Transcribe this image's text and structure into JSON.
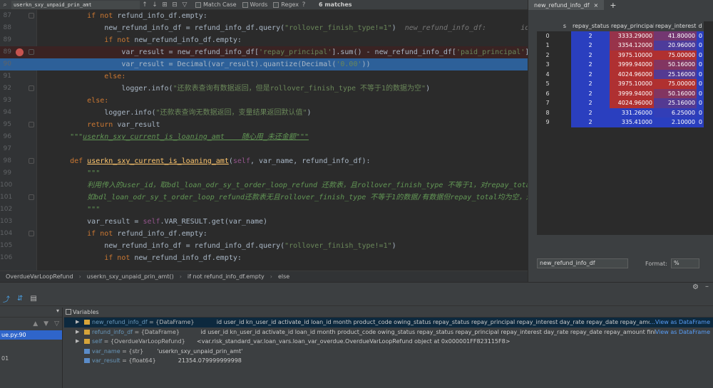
{
  "findbar": {
    "query": "userkn_sxy_unpaid_prin_amt",
    "match_case": "Match Case",
    "words": "Words",
    "regex": "Regex",
    "help": "?",
    "matches": "6 matches"
  },
  "editor": {
    "lines": [
      {
        "num": "87",
        "segments": [
          {
            "t": "        if not ",
            "c": "kw"
          },
          {
            "t": "refund_info_df.empty:",
            "c": ""
          }
        ]
      },
      {
        "num": "88",
        "segments": [
          {
            "t": "            new_refund_info_df = refund_info_df.query(",
            "c": ""
          },
          {
            "t": "\"rollover_finish_type!=1\"",
            "c": "st"
          },
          {
            "t": ")  ",
            "c": ""
          },
          {
            "t": "new_refund_info_df:        id   user_i",
            "c": "hint"
          }
        ]
      },
      {
        "num": "89",
        "segments": [
          {
            "t": "            if not ",
            "c": "kw"
          },
          {
            "t": "new_refund_info_df.empty:",
            "c": ""
          }
        ]
      },
      {
        "num": "89",
        "bp": true,
        "cls": "hl-red",
        "segments": [
          {
            "t": "                var_result = new_refund_info_df[",
            "c": ""
          },
          {
            "t": "'repay_principal'",
            "c": "st"
          },
          {
            "t": "].sum() - new_refund_info_df[",
            "c": ""
          },
          {
            "t": "'paid_principal'",
            "c": "st"
          },
          {
            "t": "].sum()",
            "c": ""
          }
        ]
      },
      {
        "num": "90",
        "cls": "hl-blue",
        "segments": [
          {
            "t": "                var_result = Decimal(var_result).quantize(Decimal(",
            "c": ""
          },
          {
            "t": "'0.00'",
            "c": "st"
          },
          {
            "t": "))",
            "c": ""
          }
        ]
      },
      {
        "num": "91",
        "segments": [
          {
            "t": "            else:",
            "c": "kw"
          }
        ]
      },
      {
        "num": "92",
        "segments": [
          {
            "t": "                logger.info(",
            "c": ""
          },
          {
            "t": "\"还款表查询有数据返回，但是rollover_finish_type 不等于1的数据为空\"",
            "c": "st"
          },
          {
            "t": ")",
            "c": ""
          }
        ]
      },
      {
        "num": "93",
        "segments": [
          {
            "t": "        else:",
            "c": "kw"
          }
        ]
      },
      {
        "num": "94",
        "segments": [
          {
            "t": "            logger.info(",
            "c": ""
          },
          {
            "t": "\"还款表查询无数据返回，变量结果返回默认值\"",
            "c": "st"
          },
          {
            "t": ")",
            "c": ""
          }
        ]
      },
      {
        "num": "95",
        "segments": [
          {
            "t": "        return ",
            "c": "kw"
          },
          {
            "t": "var_result",
            "c": ""
          }
        ]
      },
      {
        "num": "96",
        "segments": [
          {
            "t": "    \"\"\"",
            "c": "cm"
          },
          {
            "t": "userkn_sxy_current_is_loaning_amt    随心用_未还金额\"\"\"",
            "c": "cm ul"
          }
        ]
      },
      {
        "num": "97",
        "segments": [
          {
            "t": "",
            "c": ""
          }
        ]
      },
      {
        "num": "98",
        "segments": [
          {
            "t": "    def ",
            "c": "kw"
          },
          {
            "t": "userkn_sxy_current_is_loaning_amt",
            "c": "fn ul"
          },
          {
            "t": "(",
            "c": ""
          },
          {
            "t": "self",
            "c": "self"
          },
          {
            "t": ", var_name, refund_info_df):",
            "c": ""
          }
        ]
      },
      {
        "num": "99",
        "segments": [
          {
            "t": "        \"\"\"",
            "c": "cm"
          }
        ]
      },
      {
        "num": "100",
        "segments": [
          {
            "t": "        利用传入的user_id，取bdl_loan_odr_sy_t_order_loop_refund 还款表，且rollover_finish_type 不等于1，对repay_total",
            "c": "cm"
          }
        ]
      },
      {
        "num": "101",
        "segments": [
          {
            "t": "        如bdl_loan_odr_sy_t_order_loop_refund还款表无且rollover_finish_type 不等于1的数据/有数据但repay_total均为空，返回",
            "c": "cm"
          }
        ]
      },
      {
        "num": "102",
        "segments": [
          {
            "t": "        \"\"\"",
            "c": "cm"
          }
        ]
      },
      {
        "num": "103",
        "segments": [
          {
            "t": "        var_result = ",
            "c": ""
          },
          {
            "t": "self",
            "c": "self"
          },
          {
            "t": ".VAR_RESULT.get(var_name)",
            "c": ""
          }
        ]
      },
      {
        "num": "104",
        "segments": [
          {
            "t": "        if not ",
            "c": "kw"
          },
          {
            "t": "refund_info_df.empty:",
            "c": ""
          }
        ]
      },
      {
        "num": "105",
        "segments": [
          {
            "t": "            new_refund_info_df = refund_info_df.query(",
            "c": ""
          },
          {
            "t": "\"rollover_finish_type!=1\"",
            "c": "st"
          },
          {
            "t": ")",
            "c": ""
          }
        ]
      },
      {
        "num": "106",
        "segments": [
          {
            "t": "            if not ",
            "c": "kw"
          },
          {
            "t": "new_refund_info_df.empty:",
            "c": ""
          }
        ]
      }
    ]
  },
  "breadcrumb": [
    "OverdueVarLoopRefund",
    "userkn_sxy_unpaid_prin_amt()",
    "if not refund_info_df.empty",
    "else"
  ],
  "right_panel": {
    "tab": "new_refund_info_df",
    "add": "+",
    "columns": [
      "s",
      "repay_status",
      "repay_principal",
      "repay_interest",
      "d"
    ],
    "rows": [
      {
        "idx": "0",
        "status": "2",
        "principal": "3333.29000",
        "interest": "41.80000",
        "d": "0"
      },
      {
        "idx": "1",
        "status": "2",
        "principal": "3354.12000",
        "interest": "20.96000",
        "d": "0"
      },
      {
        "idx": "2",
        "status": "2",
        "principal": "3975.10000",
        "interest": "75.00000",
        "d": "0"
      },
      {
        "idx": "3",
        "status": "2",
        "principal": "3999.94000",
        "interest": "50.16000",
        "d": "0"
      },
      {
        "idx": "4",
        "status": "2",
        "principal": "4024.96000",
        "interest": "25.16000",
        "d": "0"
      },
      {
        "idx": "5",
        "status": "2",
        "principal": "3975.10000",
        "interest": "75.00000",
        "d": "0"
      },
      {
        "idx": "6",
        "status": "2",
        "principal": "3999.94000",
        "interest": "50.16000",
        "d": "0"
      },
      {
        "idx": "7",
        "status": "2",
        "principal": "4024.96000",
        "interest": "25.16000",
        "d": "0"
      },
      {
        "idx": "8",
        "status": "2",
        "principal": "331.26000",
        "interest": "6.25000",
        "d": "0"
      },
      {
        "idx": "9",
        "status": "2",
        "principal": "335.41000",
        "interest": "2.10000",
        "d": "0"
      }
    ],
    "name_field": "new_refund_info_df",
    "format_label": "Format:",
    "format_value": "%"
  },
  "debugger": {
    "variables_title": "Variables",
    "frame_file": "ue.py:90",
    "frame_item": "01",
    "variables": [
      {
        "name": "new_refund_info_df",
        "type": " = {DataFrame} ",
        "cols": "id   user_id kn_user_id   activate_id     loan_id  month product_code owing_status repay_status   repay_principal   repay_interest  day_rate          repay_date  repay_amount",
        "link": "...View as DataFrame",
        "selected": true,
        "expand": true
      },
      {
        "name": "refund_info_df",
        "type": " = {DataFrame} ",
        "cols": "id   user_id kn_user_id   activate_id     loan_id  month product_code owing_status repay_status  repay_principal  repay_interest  day_rate          repay_date  repay_amount      fini...",
        "link": "View as DataFrame",
        "expand": true
      },
      {
        "name": "self",
        "type": " = {OverdueVarLoopRefund} ",
        "cols": "<var.risk_standard_var.loan_vars.loan_var_overdue.OverdueVarLoopRefund object at 0x000001FF823115F8>",
        "link": "",
        "expand": true
      },
      {
        "name": "var_name",
        "type": " = {str} ",
        "cols": "'userkn_sxy_unpaid_prin_amt'",
        "link": "",
        "prim": true
      },
      {
        "name": "var_result",
        "type": " = {float64} ",
        "cols": "21354.079999999998",
        "link": "",
        "prim": true
      }
    ]
  },
  "colors": {
    "blue_cell": "#2a3fbf",
    "red_cell": "#b03030",
    "selection": "#2d6099"
  }
}
